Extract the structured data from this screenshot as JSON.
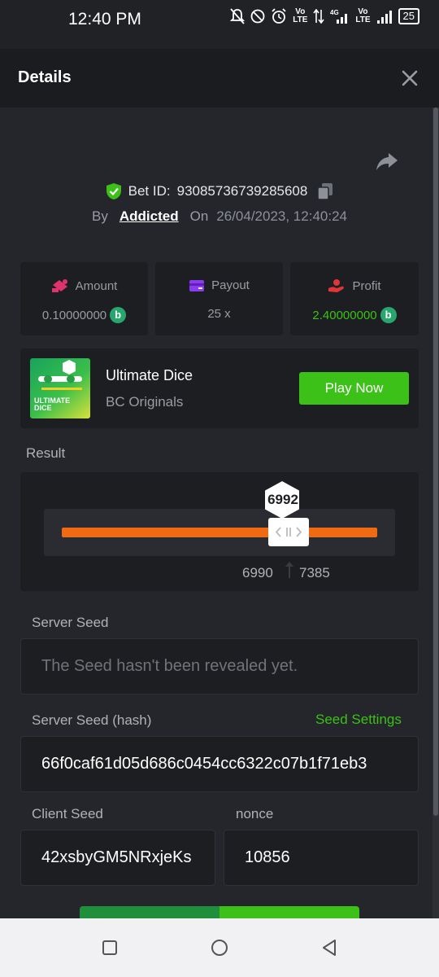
{
  "status_bar": {
    "time": "12:40 PM",
    "battery": "25",
    "network_4g": "4G",
    "volte": "Vo\nLTE"
  },
  "header": {
    "title": "Details"
  },
  "bet": {
    "id_label": "Bet ID:",
    "id": "93085736739285608",
    "by_label": "By",
    "user": "Addicted",
    "on_label": "On",
    "datetime": "26/04/2023, 12:40:24"
  },
  "stats": {
    "amount_label": "Amount",
    "amount_value": "0.10000000",
    "payout_label": "Payout",
    "payout_value": "25 x",
    "profit_label": "Profit",
    "profit_value": "2.40000000",
    "coin_symbol": "b"
  },
  "game": {
    "name": "Ultimate Dice",
    "provider": "BC Originals",
    "play_label": "Play Now",
    "thumb_text": "ULTIMATE DICE"
  },
  "result": {
    "label": "Result",
    "value": "6992",
    "range_low": "6990",
    "range_high": "7385"
  },
  "server_seed": {
    "label": "Server Seed",
    "placeholder": "The Seed hasn't been revealed yet."
  },
  "server_seed_hash": {
    "label": "Server Seed (hash)",
    "settings_link": "Seed Settings",
    "value": "66f0caf61d05d686c0454cc6322c07b1f71eb3"
  },
  "client_seed": {
    "label": "Client Seed",
    "value": "42xsbyGM5NRxjeKs"
  },
  "nonce": {
    "label": "nonce",
    "value": "10856"
  },
  "colors": {
    "accent_green": "#3bc117",
    "slider_orange": "#ef6a12",
    "background": "#24262b",
    "card": "#1d1e21"
  }
}
